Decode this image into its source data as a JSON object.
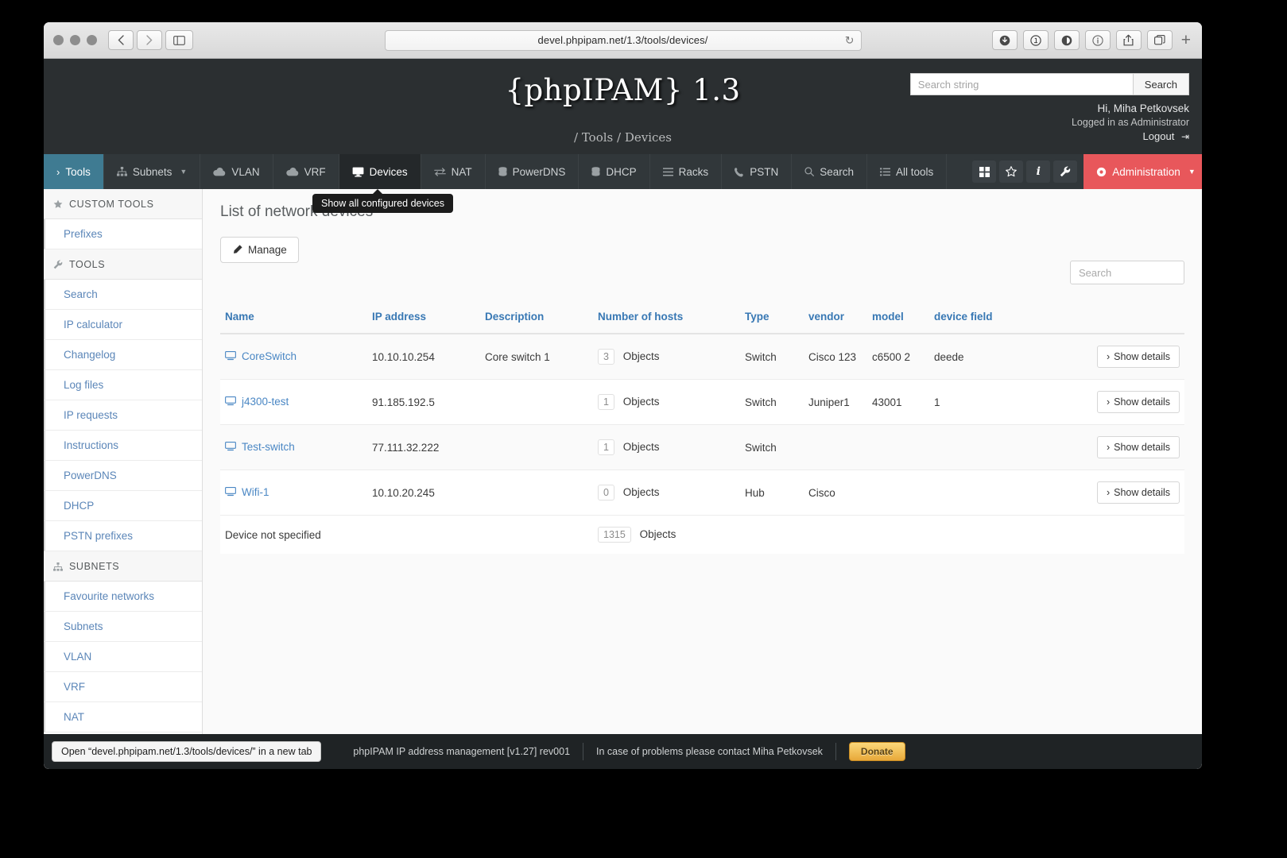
{
  "browser": {
    "url": "devel.phpipam.net/1.3/tools/devices/",
    "reload_icon": "reload-icon",
    "back_icon": "chevron-left-icon",
    "forward_icon": "chevron-right-icon",
    "sidebar_toggle_icon": "sidebar-toggle-icon",
    "toolbar_icons": [
      "download-icon",
      "one-password-icon",
      "adblock-icon",
      "info-icon",
      "share-icon",
      "tabs-icon"
    ],
    "new_tab_label": "+"
  },
  "header": {
    "logo": "{phpIPAM} 1.3",
    "breadcrumb": "/ Tools / Devices",
    "search_placeholder": "Search string",
    "search_value": "",
    "search_button": "Search",
    "greeting": "Hi, Miha Petkovsek",
    "role": "Logged in as Administrator",
    "logout": "Logout"
  },
  "nav": {
    "items": [
      {
        "label": "Tools",
        "icon": "chevron-right-icon",
        "state": "active-blue"
      },
      {
        "label": "Subnets",
        "icon": "sitemap-icon",
        "state": "",
        "caret": true
      },
      {
        "label": "VLAN",
        "icon": "cloud-icon",
        "state": ""
      },
      {
        "label": "VRF",
        "icon": "cloud-icon",
        "state": ""
      },
      {
        "label": "Devices",
        "icon": "desktop-icon",
        "state": "active-dark"
      },
      {
        "label": "NAT",
        "icon": "exchange-icon",
        "state": ""
      },
      {
        "label": "PowerDNS",
        "icon": "database-icon",
        "state": ""
      },
      {
        "label": "DHCP",
        "icon": "database-icon",
        "state": ""
      },
      {
        "label": "Racks",
        "icon": "list-icon",
        "state": ""
      },
      {
        "label": "PSTN",
        "icon": "phone-icon",
        "state": ""
      },
      {
        "label": "Search",
        "icon": "search-icon",
        "state": ""
      },
      {
        "label": "All tools",
        "icon": "list-ul-icon",
        "state": ""
      }
    ],
    "icon_buttons": [
      "grid-icon",
      "star-icon",
      "info-icon",
      "wrench-icon"
    ],
    "admin_label": "Administration",
    "admin_icon": "gear-icon",
    "admin_color": "#e8575b",
    "tooltip": "Show all configured devices"
  },
  "sidebar": {
    "sections": [
      {
        "title": "CUSTOM TOOLS",
        "icon": "star-icon",
        "items": [
          "Prefixes"
        ]
      },
      {
        "title": "TOOLS",
        "icon": "wrench-icon",
        "items": [
          "Search",
          "IP calculator",
          "Changelog",
          "Log files",
          "IP requests",
          "Instructions",
          "PowerDNS",
          "DHCP",
          "PSTN prefixes"
        ]
      },
      {
        "title": "SUBNETS",
        "icon": "sitemap-icon",
        "items": [
          "Favourite networks",
          "Subnets",
          "VLAN",
          "VRF",
          "NAT"
        ]
      }
    ]
  },
  "main": {
    "page_title": "List of network devices",
    "manage_label": "Manage",
    "manage_icon": "pencil-icon",
    "table_search_placeholder": "Search",
    "table_search_value": "",
    "columns": [
      "Name",
      "IP address",
      "Description",
      "Number of hosts",
      "Type",
      "vendor",
      "model",
      "device field",
      ""
    ],
    "rows": [
      {
        "name": "CoreSwitch",
        "icon": "desktop-icon",
        "ip": "10.10.10.254",
        "description": "Core switch 1",
        "hosts_count": "3",
        "hosts_label": "Objects",
        "type": "Switch",
        "vendor": "Cisco 123",
        "model": "c6500 2",
        "device_field": "deede",
        "action": "Show details"
      },
      {
        "name": "j4300-test",
        "icon": "desktop-icon",
        "ip": "91.185.192.5",
        "description": "",
        "hosts_count": "1",
        "hosts_label": "Objects",
        "type": "Switch",
        "vendor": "Juniper1",
        "model": "43001",
        "device_field": "1",
        "action": "Show details"
      },
      {
        "name": "Test-switch",
        "icon": "desktop-icon",
        "ip": "77.111.32.222",
        "description": "",
        "hosts_count": "1",
        "hosts_label": "Objects",
        "type": "Switch",
        "vendor": "",
        "model": "",
        "device_field": "",
        "action": "Show details"
      },
      {
        "name": "Wifi-1",
        "icon": "desktop-icon",
        "ip": "10.10.20.245",
        "description": "",
        "hosts_count": "0",
        "hosts_label": "Objects",
        "type": "Hub",
        "vendor": "Cisco",
        "model": "",
        "device_field": "",
        "action": "Show details"
      }
    ],
    "not_specified": {
      "label": "Device not specified",
      "hosts_count": "1315",
      "hosts_label": "Objects"
    }
  },
  "footer": {
    "version": "phpIPAM IP address management [v1.27] rev001",
    "contact": "In case of problems please contact Miha Petkovsek",
    "donate": "Donate"
  },
  "status_bar": {
    "text": "Open “devel.phpipam.net/1.3/tools/devices/” in a new tab"
  }
}
